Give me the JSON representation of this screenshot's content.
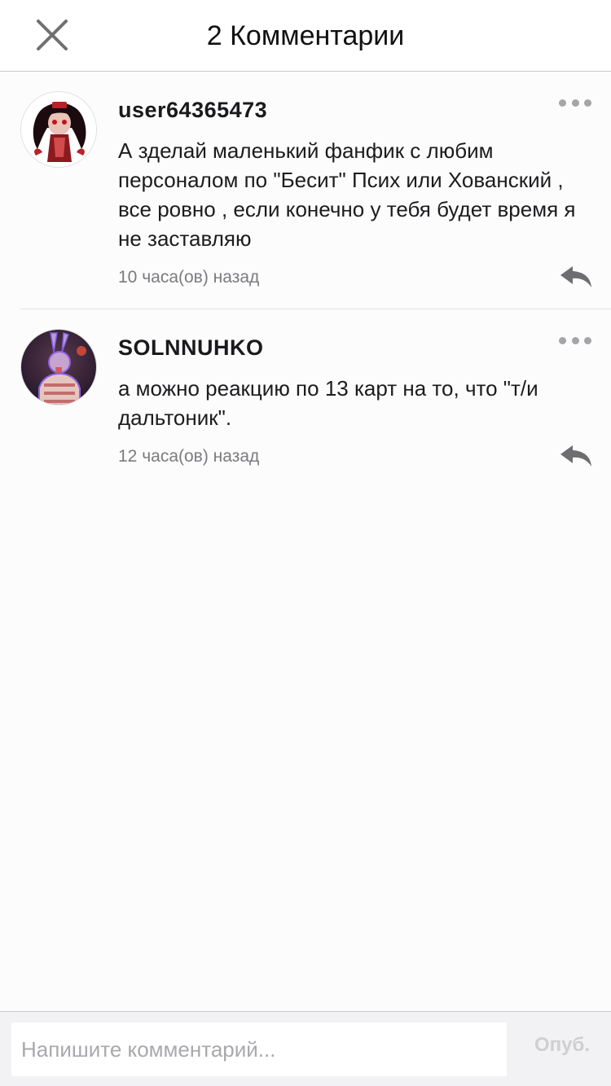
{
  "header": {
    "close_icon": "close-icon",
    "title": "2 Комментарии"
  },
  "comments": [
    {
      "username": "user64365473",
      "text": "А зделай маленький фанфик с любим персоналом по \"Бесит\" Псих или Хованский , все ровно , если конечно у тебя будет время я не заставляю",
      "time": "10 часа(ов) назад",
      "avatar_icon": "user-avatar",
      "more_icon": "more-dots-icon",
      "reply_icon": "reply-arrow-icon"
    },
    {
      "username": "SOLNNUHKO",
      "text": "а можно реакцию по 13 карт на то, что \"т/и дальтоник\".",
      "time": "12 часа(ов) назад",
      "avatar_icon": "user-avatar",
      "more_icon": "more-dots-icon",
      "reply_icon": "reply-arrow-icon"
    }
  ],
  "compose": {
    "placeholder": "Напишите комментарий...",
    "value": "",
    "publish_label": "Опуб."
  },
  "colors": {
    "background": "#fcfcfd",
    "divider": "#c8c8cc",
    "secondary_text": "#7b7b7e",
    "icon_gray": "#6e6e70",
    "publish_disabled": "#cfcfd2"
  }
}
